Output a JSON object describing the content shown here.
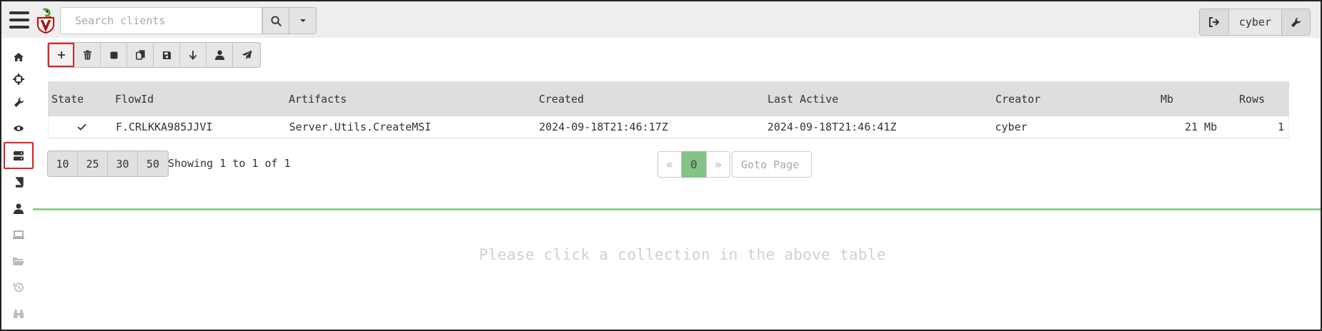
{
  "search": {
    "placeholder": "Search clients"
  },
  "user": {
    "name": "cyber"
  },
  "toolbar": {
    "buttons": [
      {
        "name": "new-collection-button",
        "icon": "plus-icon"
      },
      {
        "name": "delete-button",
        "icon": "trash-icon"
      },
      {
        "name": "stop-button",
        "icon": "stop-icon"
      },
      {
        "name": "copy-button",
        "icon": "copy-icon"
      },
      {
        "name": "save-button",
        "icon": "save-icon"
      },
      {
        "name": "download-button",
        "icon": "arrow-down-icon"
      },
      {
        "name": "user-button",
        "icon": "user-icon"
      },
      {
        "name": "send-button",
        "icon": "paper-plane-icon"
      }
    ]
  },
  "sidebar": {
    "items": [
      {
        "name": "home",
        "icon": "home-icon"
      },
      {
        "name": "hunt",
        "icon": "crosshairs-icon"
      },
      {
        "name": "tools",
        "icon": "wrench-icon"
      },
      {
        "name": "monitor",
        "icon": "eye-icon"
      },
      {
        "name": "server-artifacts",
        "icon": "server-icon",
        "active": true
      },
      {
        "name": "notebooks",
        "icon": "book-icon"
      },
      {
        "name": "users",
        "icon": "user-icon"
      },
      {
        "name": "client",
        "icon": "laptop-icon"
      },
      {
        "name": "files",
        "icon": "folder-open-icon"
      },
      {
        "name": "history",
        "icon": "history-icon"
      },
      {
        "name": "binoculars",
        "icon": "binoculars-icon"
      }
    ]
  },
  "table": {
    "columns": [
      "State",
      "FlowId",
      "Artifacts",
      "Created",
      "Last Active",
      "Creator",
      "Mb",
      "Rows"
    ],
    "rows": [
      {
        "state_icon": "check-icon",
        "flow_id": "F.CRLKKA985JJVI",
        "artifacts": "Server.Utils.CreateMSI",
        "created": "2024-09-18T21:46:17Z",
        "last_active": "2024-09-18T21:46:41Z",
        "creator": "cyber",
        "mb": "21 Mb",
        "rows": "1"
      }
    ]
  },
  "pagination": {
    "page_sizes": [
      "10",
      "25",
      "30",
      "50"
    ],
    "showing": "Showing 1 to 1 of 1",
    "prev": "«",
    "current": "0",
    "next": "»",
    "goto_placeholder": "Goto Page"
  },
  "details": {
    "empty_message": "Please click a collection in the above table"
  },
  "colors": {
    "accent_green": "#8fcd8f",
    "highlight_red": "#e02020"
  }
}
